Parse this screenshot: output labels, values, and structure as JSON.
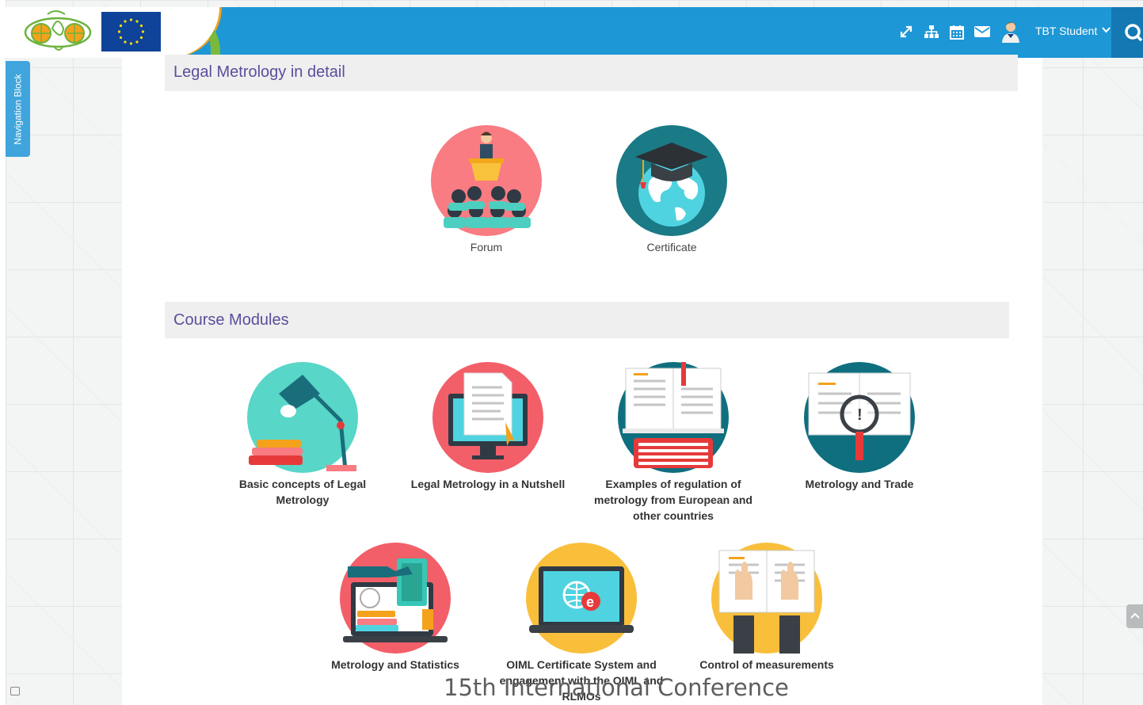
{
  "header": {
    "user_name": "TBT Student",
    "icons": [
      "expand-icon",
      "sitemap-icon",
      "calendar-icon",
      "envelope-icon",
      "user-avatar-icon",
      "chevron-down-icon",
      "search-icon"
    ],
    "colors": {
      "bar": "#1e97d6",
      "search": "#1478b3"
    }
  },
  "nav_block": {
    "label": "Navigation Block"
  },
  "sections": {
    "detail": {
      "title": "Legal Metrology in detail",
      "tiles": [
        {
          "label": "Forum",
          "icon": "forum-lecture-icon",
          "color": "#f87c82"
        },
        {
          "label": "Certificate",
          "icon": "graduation-globe-icon",
          "color": "#1a7a86"
        }
      ]
    },
    "modules": {
      "title": "Course Modules",
      "tiles": [
        {
          "label": "Basic concepts of Legal Metrology",
          "icon": "desk-lamp-books-icon",
          "color": "#58d6c8"
        },
        {
          "label": "Legal Metrology in a Nutshell",
          "icon": "monitor-document-icon",
          "color": "#f25f69"
        },
        {
          "label": "Examples of regulation of metrology from European and other countries",
          "icon": "book-keyboard-icon",
          "color": "#0f6f7f"
        },
        {
          "label": "Metrology and Trade",
          "icon": "book-magnifier-icon",
          "color": "#0f6f7f"
        },
        {
          "label": "Metrology and Statistics",
          "icon": "laptop-books-icon",
          "color": "#f25f69"
        },
        {
          "label": "OIML Certificate System and engagement with the OIML and RLMOs",
          "icon": "monitor-globe-icon",
          "color": "#f9bf3b"
        },
        {
          "label": "Control of measurements",
          "icon": "hands-book-icon",
          "color": "#f9bf3b"
        }
      ]
    }
  },
  "footer_overlay": "15th International Conference"
}
